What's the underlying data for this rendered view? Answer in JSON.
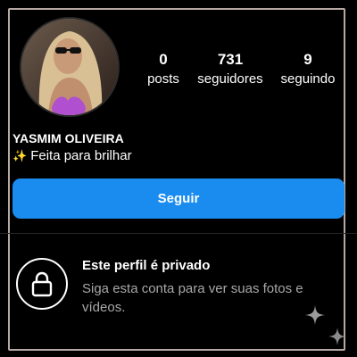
{
  "profile": {
    "username": "YASMIM OLIVEIRA",
    "bio_emoji": "✨",
    "bio": "Feita para brilhar"
  },
  "stats": {
    "posts_count": "0",
    "posts_label": "posts",
    "followers_count": "731",
    "followers_label": "seguidores",
    "following_count": "9",
    "following_label": "seguindo"
  },
  "actions": {
    "follow_label": "Seguir"
  },
  "private_notice": {
    "title": "Este perfil é privado",
    "description": "Siga esta conta para ver suas fotos e vídeos."
  },
  "colors": {
    "background": "#000000",
    "accent": "#1a8cf0",
    "muted_text": "#a8a8a8"
  },
  "icons": {
    "lock": "lock-icon",
    "sparkle": "sparkle-icon"
  }
}
